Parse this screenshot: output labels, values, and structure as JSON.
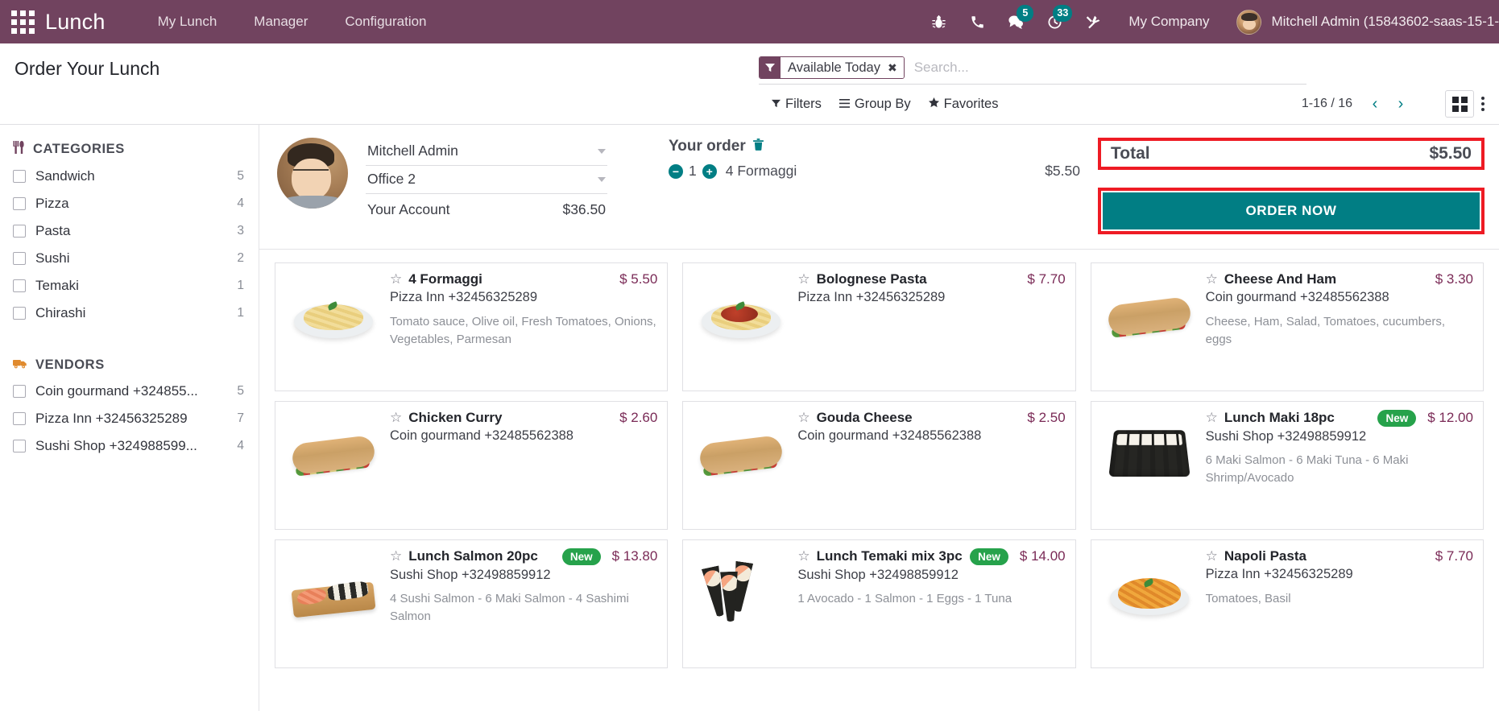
{
  "topbar": {
    "apps_icon": "apps-grid-icon",
    "app_name": "Lunch",
    "menus": [
      "My Lunch",
      "Manager",
      "Configuration"
    ],
    "sys_icons": [
      {
        "name": "bug-icon",
        "badge": null
      },
      {
        "name": "phone-icon",
        "badge": null
      },
      {
        "name": "messages-icon",
        "badge": "5"
      },
      {
        "name": "activities-clock-icon",
        "badge": "33"
      },
      {
        "name": "tools-icon",
        "badge": null
      }
    ],
    "company": "My Company",
    "user": "Mitchell Admin (15843602-saas-15-1-",
    "bg_color": "#71435f"
  },
  "control_panel": {
    "page_title": "Order Your Lunch",
    "search": {
      "facet_label": "Available Today",
      "facet_icon": "filter-funnel-icon",
      "facet_remove": "✖",
      "placeholder": "Search..."
    },
    "dropdowns": [
      {
        "label": "Filters",
        "icon": "filter-icon"
      },
      {
        "label": "Group By",
        "icon": "hamburger-icon"
      },
      {
        "label": "Favorites",
        "icon": "star-icon"
      }
    ],
    "pager": {
      "value": "1-16 / 16",
      "prev": "‹",
      "next": "›"
    },
    "view_switcher": {
      "active": "kanban-view-icon",
      "more": "options-dots-icon"
    }
  },
  "sidebar": {
    "categories_title": "CATEGORIES",
    "categories_icon": "cutlery-icon",
    "categories": [
      {
        "label": "Sandwich",
        "count": "5"
      },
      {
        "label": "Pizza",
        "count": "4"
      },
      {
        "label": "Pasta",
        "count": "3"
      },
      {
        "label": "Sushi",
        "count": "2"
      },
      {
        "label": "Temaki",
        "count": "1"
      },
      {
        "label": "Chirashi",
        "count": "1"
      }
    ],
    "vendors_title": "VENDORS",
    "vendors_icon": "delivery-truck-icon",
    "vendors": [
      {
        "label": "Coin gourmand +324855...",
        "count": "5"
      },
      {
        "label": "Pizza Inn +32456325289",
        "count": "7"
      },
      {
        "label": "Sushi Shop +324988599...",
        "count": "4"
      }
    ]
  },
  "order_header": {
    "user_name": "Mitchell Admin",
    "location": "Office 2",
    "account_label": "Your Account",
    "account_value": "$36.50",
    "your_order_title": "Your order",
    "trash_icon": "trash-icon",
    "lines": [
      {
        "qty": "1",
        "name": "4 Formaggi",
        "price": "$5.50",
        "minus": "minus-circle-icon",
        "plus": "plus-circle-icon"
      }
    ],
    "total_label": "Total",
    "total_value": "$5.50",
    "order_now_label": "ORDER NOW",
    "highlight_color": "#ee1b24",
    "button_color": "#017e84"
  },
  "products": [
    {
      "name": "4 Formaggi",
      "vendor": "Pizza Inn +32456325289",
      "description": "Tomato sauce, Olive oil, Fresh Tomatoes, Onions, Vegetables, Parmesan",
      "price": "$ 5.50",
      "new": null,
      "thumb": "pasta-formaggi-image"
    },
    {
      "name": "Bolognese Pasta",
      "vendor": "Pizza Inn +32456325289",
      "description": "",
      "price": "$ 7.70",
      "new": null,
      "thumb": "pasta-bolognese-image"
    },
    {
      "name": "Cheese And Ham",
      "vendor": "Coin gourmand +32485562388",
      "description": "Cheese, Ham, Salad, Tomatoes, cucumbers, eggs",
      "price": "$ 3.30",
      "new": null,
      "thumb": "sandwich-cheese-ham-image"
    },
    {
      "name": "Chicken Curry",
      "vendor": "Coin gourmand +32485562388",
      "description": "",
      "price": "$ 2.60",
      "new": null,
      "thumb": "sandwich-chicken-curry-image"
    },
    {
      "name": "Gouda Cheese",
      "vendor": "Coin gourmand +32485562388",
      "description": "",
      "price": "$ 2.50",
      "new": null,
      "thumb": "sandwich-gouda-image"
    },
    {
      "name": "Lunch Maki 18pc",
      "vendor": "Sushi Shop +32498859912",
      "description": "6 Maki Salmon - 6 Maki Tuna - 6 Maki Shrimp/Avocado",
      "price": "$ 12.00",
      "new": "New",
      "thumb": "sushi-maki-image"
    },
    {
      "name": "Lunch Salmon 20pc",
      "vendor": "Sushi Shop +32498859912",
      "description": "4 Sushi Salmon - 6 Maki Salmon - 4 Sashimi Salmon",
      "price": "$ 13.80",
      "new": "New",
      "thumb": "sushi-salmon-board-image"
    },
    {
      "name": "Lunch Temaki mix 3pc",
      "vendor": "Sushi Shop +32498859912",
      "description": "1 Avocado - 1 Salmon - 1 Eggs - 1 Tuna",
      "price": "$ 14.00",
      "new": "New",
      "thumb": "temaki-image"
    },
    {
      "name": "Napoli Pasta",
      "vendor": "Pizza Inn +32456325289",
      "description": "Tomatoes, Basil",
      "price": "$ 7.70",
      "new": null,
      "thumb": "pasta-napoli-image"
    }
  ]
}
